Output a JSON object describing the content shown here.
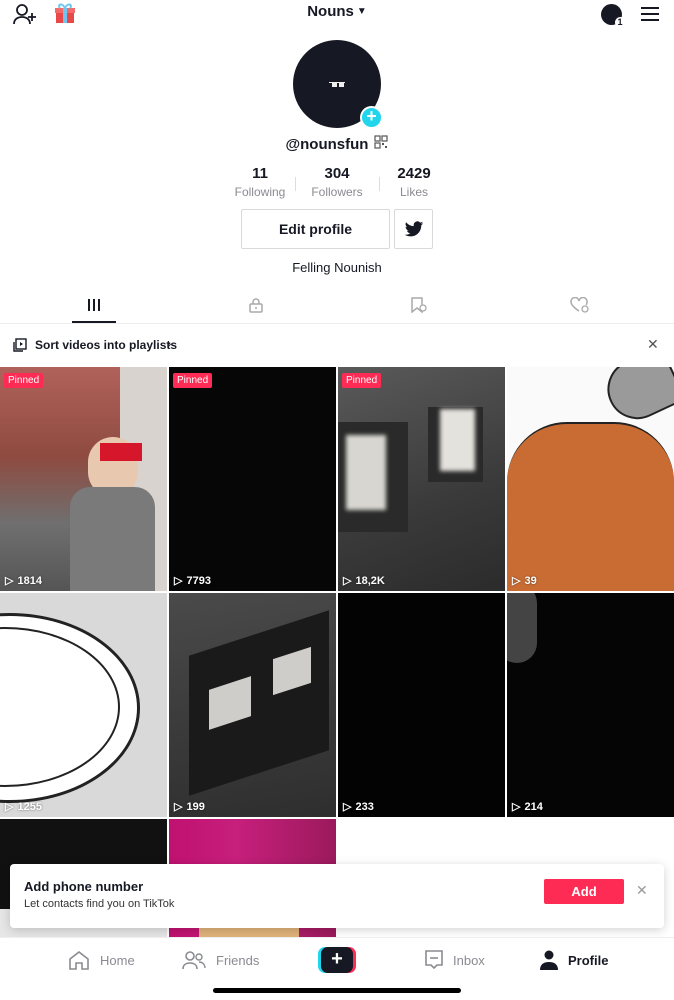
{
  "header": {
    "title": "Nouns",
    "notification_count": "1"
  },
  "profile": {
    "username": "@nounsfun",
    "stats": [
      {
        "value": "11",
        "label": "Following"
      },
      {
        "value": "304",
        "label": "Followers"
      },
      {
        "value": "2429",
        "label": "Likes"
      }
    ],
    "edit_label": "Edit profile",
    "bio": "Felling Nounish"
  },
  "sort_bar": {
    "label": "Sort videos into playlists"
  },
  "videos": [
    {
      "pinned": "Pinned",
      "views": "1814"
    },
    {
      "pinned": "Pinned",
      "views": "7793"
    },
    {
      "pinned": "Pinned",
      "views": "18,2K"
    },
    {
      "views": "39"
    },
    {
      "views": "1255"
    },
    {
      "views": "199"
    },
    {
      "views": "233"
    },
    {
      "views": "214"
    }
  ],
  "toast": {
    "title": "Add phone number",
    "subtitle": "Let contacts find you on TikTok",
    "button": "Add"
  },
  "nav": {
    "home": "Home",
    "friends": "Friends",
    "inbox": "Inbox",
    "profile": "Profile"
  },
  "colors": {
    "accent": "#fe2c55",
    "cyan": "#20d5ec",
    "text": "#161823"
  }
}
